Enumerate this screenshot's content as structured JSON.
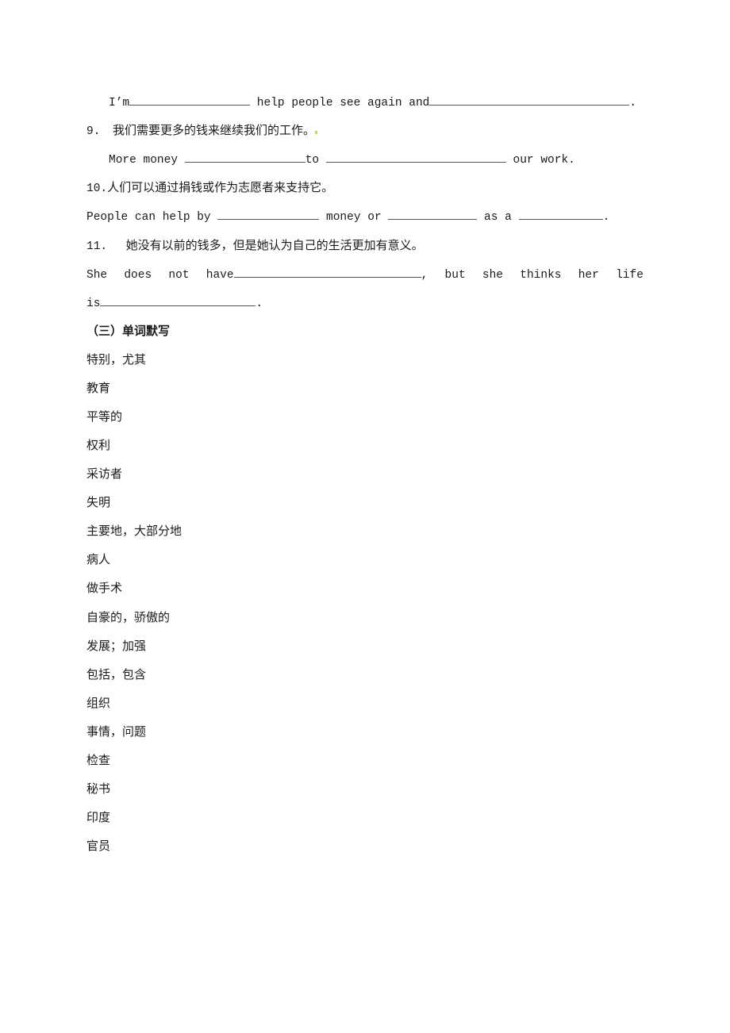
{
  "worksheet": {
    "item8_tail": {
      "prefix": "I’m",
      "middle": " help people see again and",
      "suffix": "."
    },
    "item9": {
      "number": "9.",
      "chinese": "我们需要更多的钱来继续我们的工作。",
      "english_prefix": "More money ",
      "english_middle": "to ",
      "english_suffix": " our work."
    },
    "item10": {
      "number": "10.",
      "chinese": "人们可以通过捐钱或作为志愿者来支持它。",
      "english_prefix": "People can help by ",
      "english_middle1": " money or ",
      "english_middle2": " as a ",
      "english_suffix": "."
    },
    "item11": {
      "number": "11.",
      "chinese": "她没有以前的钱多，但是她认为自己的生活更加有意义。",
      "english_words_line1": [
        "She",
        "does",
        "not",
        "have"
      ],
      "english_comma": ",",
      "english_words_line1_tail": [
        "but",
        "she",
        "thinks",
        "her",
        "life"
      ],
      "english_line2_prefix": "is",
      "english_line2_suffix": "."
    },
    "section3": {
      "title": "（三）单词默写",
      "vocab": [
        "特别，尤其",
        "教育",
        "平等的",
        "权利",
        "采访者",
        "失明",
        "主要地，大部分地",
        "病人",
        "做手术",
        "自豪的，骄傲的",
        "发展；加强",
        "包括，包含",
        "组织",
        "事情，问题",
        "检查",
        "秘书",
        "印度",
        "官员"
      ]
    }
  }
}
